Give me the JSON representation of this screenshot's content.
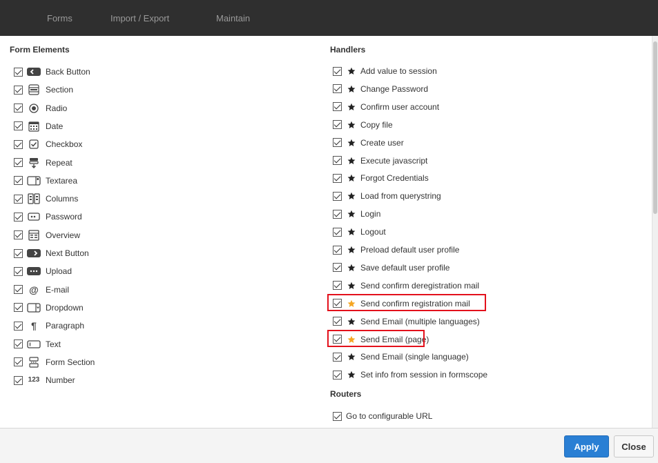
{
  "tabs": [
    {
      "label": "Forms"
    },
    {
      "label": "Import / Export"
    },
    {
      "label": "Maintain"
    }
  ],
  "form_elements": {
    "title": "Form Elements",
    "items": [
      {
        "label": "Back Button",
        "icon": "back-button-icon"
      },
      {
        "label": "Section",
        "icon": "section-icon"
      },
      {
        "label": "Radio",
        "icon": "radio-icon"
      },
      {
        "label": "Date",
        "icon": "calendar-icon"
      },
      {
        "label": "Checkbox",
        "icon": "checkbox-icon"
      },
      {
        "label": "Repeat",
        "icon": "repeat-icon"
      },
      {
        "label": "Textarea",
        "icon": "textarea-icon"
      },
      {
        "label": "Columns",
        "icon": "columns-icon"
      },
      {
        "label": "Password",
        "icon": "password-icon"
      },
      {
        "label": "Overview",
        "icon": "overview-icon"
      },
      {
        "label": "Next Button",
        "icon": "next-button-icon"
      },
      {
        "label": "Upload",
        "icon": "upload-icon"
      },
      {
        "label": "E-mail",
        "icon": "at-sign-icon"
      },
      {
        "label": "Dropdown",
        "icon": "dropdown-icon"
      },
      {
        "label": "Paragraph",
        "icon": "paragraph-icon"
      },
      {
        "label": "Text",
        "icon": "text-field-icon"
      },
      {
        "label": "Form Section",
        "icon": "form-section-icon"
      },
      {
        "label": "Number",
        "icon": "number-icon"
      }
    ]
  },
  "handlers": {
    "title": "Handlers",
    "items": [
      {
        "label": "Add value to session",
        "starred": false
      },
      {
        "label": "Change Password",
        "starred": false
      },
      {
        "label": "Confirm user account",
        "starred": false
      },
      {
        "label": "Copy file",
        "starred": false
      },
      {
        "label": "Create user",
        "starred": false
      },
      {
        "label": "Execute javascript",
        "starred": false
      },
      {
        "label": "Forgot Credentials",
        "starred": false
      },
      {
        "label": "Load from querystring",
        "starred": false
      },
      {
        "label": "Login",
        "starred": false
      },
      {
        "label": "Logout",
        "starred": false
      },
      {
        "label": "Preload default user profile",
        "starred": false
      },
      {
        "label": "Save default user profile",
        "starred": false
      },
      {
        "label": "Send confirm deregistration mail",
        "starred": false
      },
      {
        "label": "Send confirm registration mail",
        "starred": true
      },
      {
        "label": "Send Email (multiple languages)",
        "starred": false
      },
      {
        "label": "Send Email (page)",
        "starred": true
      },
      {
        "label": "Send Email (single language)",
        "starred": false
      },
      {
        "label": "Set info from session in formscope",
        "starred": false
      }
    ]
  },
  "routers": {
    "title": "Routers",
    "items": [
      {
        "label": "Go to configurable URL"
      }
    ]
  },
  "footer": {
    "apply_label": "Apply",
    "close_label": "Close"
  },
  "colors": {
    "topbar": "#2f2f2f",
    "accent": "#2a7fd4",
    "highlight": "#e3101b",
    "star_default": "#222222",
    "star_highlighted": "#f5a623"
  }
}
